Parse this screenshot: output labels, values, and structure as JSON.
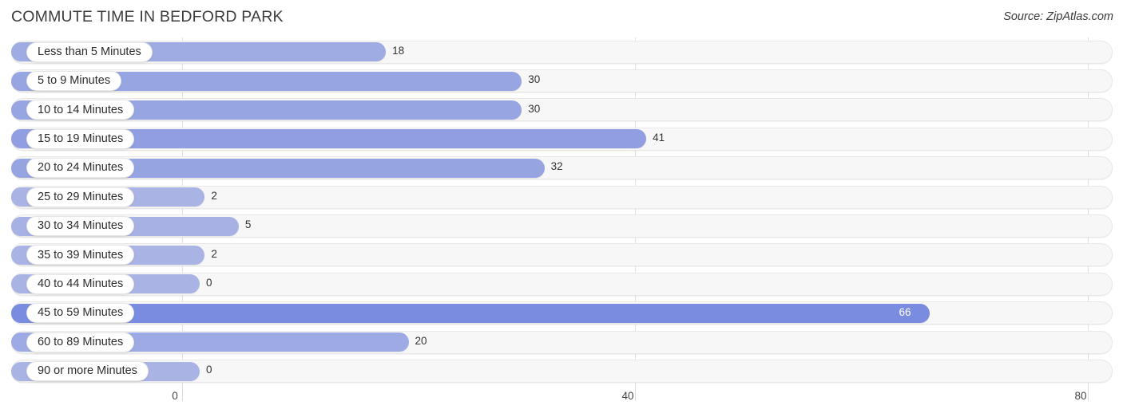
{
  "header": {
    "title": "COMMUTE TIME IN BEDFORD PARK",
    "source": "Source: ZipAtlas.com"
  },
  "colors": {
    "bar_light": "#aab4e4",
    "bar_mid": "#93a0e2",
    "bar_dark": "#7a8ce0",
    "track": "#f7f7f7",
    "gridline": "#e2e2e2",
    "label_text": "#2d2d2d",
    "value_text": "#333333",
    "value_text_inside": "#ffffff"
  },
  "chart_data": {
    "type": "bar",
    "orientation": "horizontal",
    "title": "COMMUTE TIME IN BEDFORD PARK",
    "xlabel": "",
    "ylabel": "",
    "xlim": [
      0,
      80
    ],
    "xticks": [
      0,
      40,
      80
    ],
    "xtick_labels": [
      "0",
      "40",
      "80"
    ],
    "grid": true,
    "legend": "none",
    "categories": [
      "Less than 5 Minutes",
      "5 to 9 Minutes",
      "10 to 14 Minutes",
      "15 to 19 Minutes",
      "20 to 24 Minutes",
      "25 to 29 Minutes",
      "30 to 34 Minutes",
      "35 to 39 Minutes",
      "40 to 44 Minutes",
      "45 to 59 Minutes",
      "60 to 89 Minutes",
      "90 or more Minutes"
    ],
    "values": [
      18,
      30,
      30,
      41,
      32,
      2,
      5,
      2,
      0,
      66,
      20,
      0
    ],
    "value_labels": [
      "18",
      "30",
      "30",
      "41",
      "32",
      "2",
      "5",
      "2",
      "0",
      "66",
      "20",
      "0"
    ]
  }
}
